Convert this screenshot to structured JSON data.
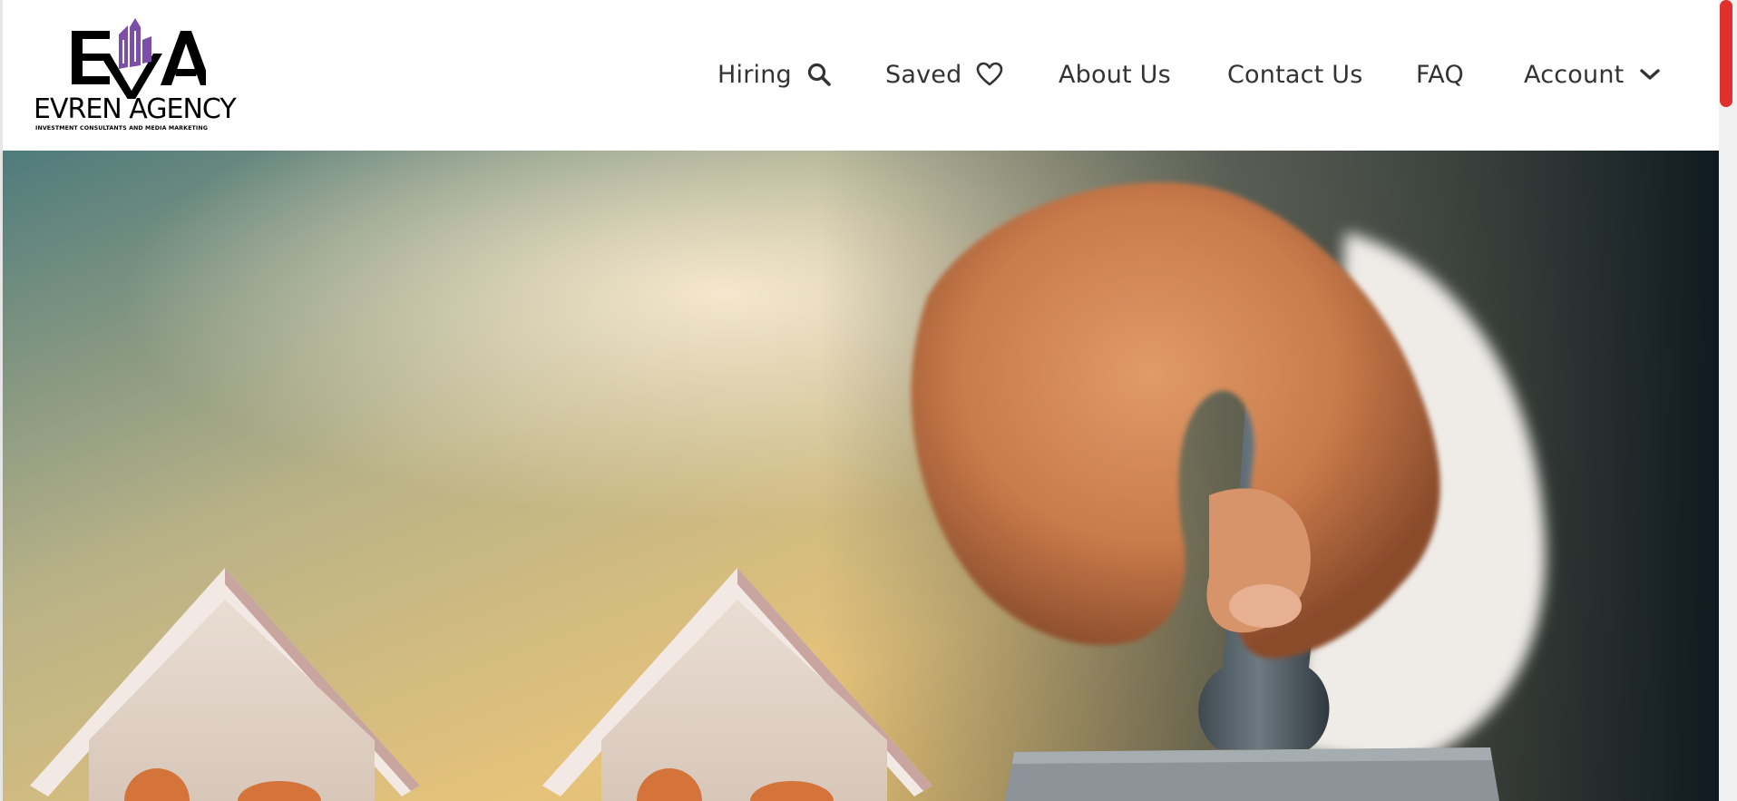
{
  "logo": {
    "monogram": "EVA",
    "name": "EVREN AGENCY",
    "tagline": "INVESTMENT CONSULTANTS AND MEDIA MARKETING",
    "accent_color": "#7b4fa8"
  },
  "nav": {
    "hiring": {
      "label": "Hiring",
      "icon": "search-icon"
    },
    "saved": {
      "label": "Saved",
      "icon": "heart-icon"
    },
    "about": {
      "label": "About Us"
    },
    "contact": {
      "label": "Contact Us"
    },
    "faq": {
      "label": "FAQ"
    },
    "account": {
      "label": "Account",
      "icon": "chevron-down-icon"
    }
  },
  "hero": {
    "image": "hand-pressing-stamp-over-model-houses"
  },
  "colors": {
    "nav_text": "#333333",
    "scrollbar_thumb": "#e0302e"
  }
}
